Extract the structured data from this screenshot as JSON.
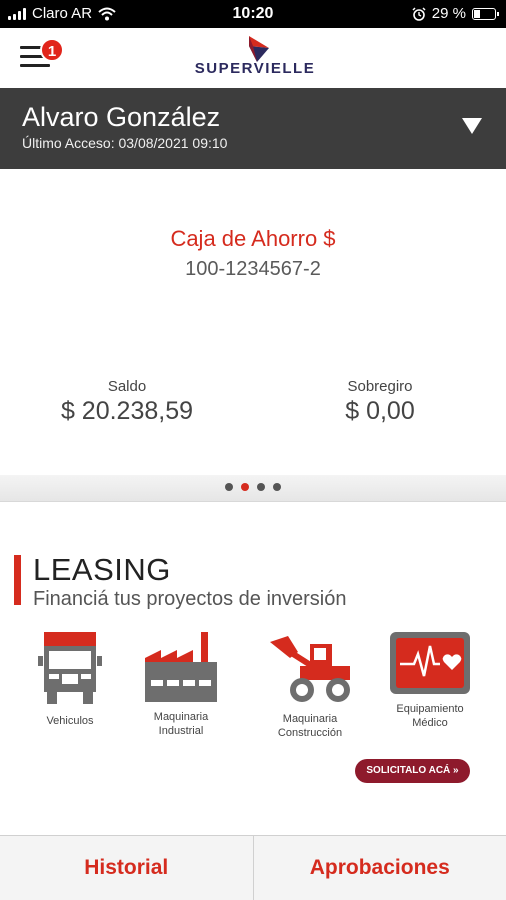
{
  "status_bar": {
    "carrier": "Claro AR",
    "time": "10:20",
    "battery": "29 %",
    "battery_level": 0.29
  },
  "header": {
    "notification_count": "1",
    "brand": "SUPERVIELLE"
  },
  "user": {
    "name": "Alvaro González",
    "last_access": "Último Acceso: 03/08/2021 09:10"
  },
  "account": {
    "type": "Caja de Ahorro $",
    "number": "100-1234567-2",
    "balance_label": "Saldo",
    "balance_value": "$ 20.238,59",
    "overdraft_label": "Sobregiro",
    "overdraft_value": "$ 0,00"
  },
  "carousel": {
    "pages": 4,
    "active": 1
  },
  "leasing": {
    "title": "LEASING",
    "subtitle": "Financiá tus proyectos de inversión",
    "categories": [
      {
        "label": "Vehiculos",
        "icon": "truck-icon"
      },
      {
        "label": "Maquinaria\nIndustrial",
        "icon": "factory-icon"
      },
      {
        "label": "Maquinaria\nConstrucción",
        "icon": "loader-icon"
      },
      {
        "label": "Equipamiento\nMédico",
        "icon": "heart-monitor-icon"
      }
    ],
    "cta": "SOLICITALO ACÁ »"
  },
  "tabs": {
    "history": "Historial",
    "approvals": "Aprobaciones"
  },
  "colors": {
    "brand_red": "#d52b1e",
    "brand_navy": "#2c2a5e",
    "user_bar": "#3d3d3d",
    "cta": "#8e1a2c"
  }
}
